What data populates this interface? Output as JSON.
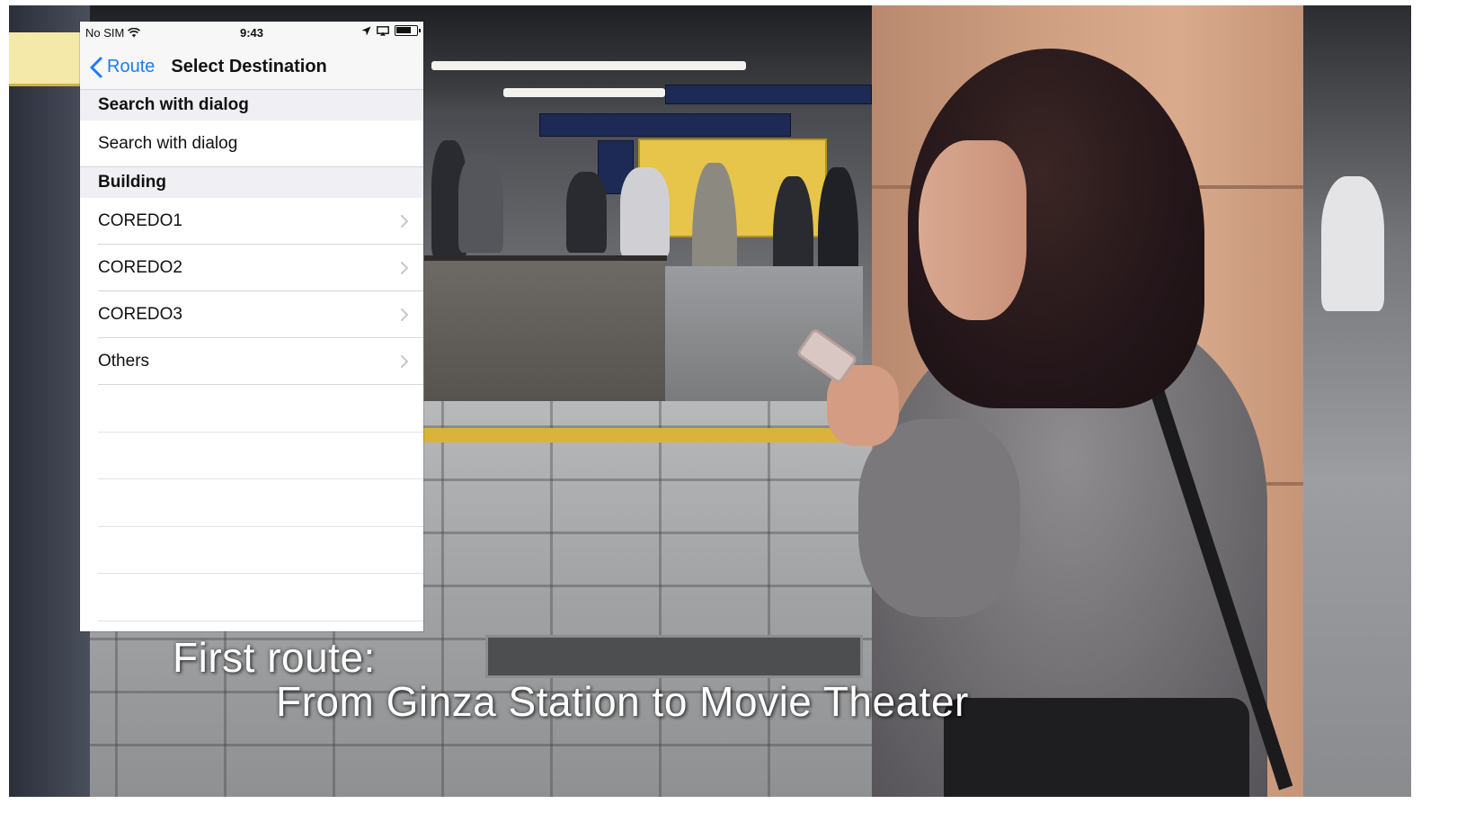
{
  "status_bar": {
    "carrier": "No SIM",
    "time": "9:43"
  },
  "nav": {
    "back_label": "Route",
    "title": "Select Destination"
  },
  "sections": [
    {
      "header": "Search with dialog",
      "items": [
        {
          "label": "Search with dialog",
          "disclosure": false
        }
      ]
    },
    {
      "header": "Building",
      "items": [
        {
          "label": "COREDO1",
          "disclosure": true
        },
        {
          "label": "COREDO2",
          "disclosure": true
        },
        {
          "label": "COREDO3",
          "disclosure": true
        },
        {
          "label": "Others",
          "disclosure": true
        }
      ]
    }
  ],
  "caption": {
    "line1": "First route:",
    "line2": "From Ginza Station to Movie Theater"
  },
  "colors": {
    "ios_blue": "#1a7cf5",
    "section_bg": "#efeff4",
    "nav_bg": "#f7f7f7"
  }
}
